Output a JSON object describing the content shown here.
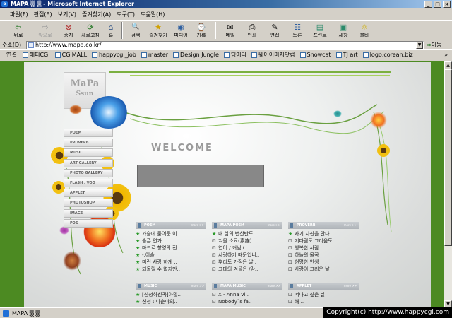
{
  "window": {
    "title": "MAPA ▒ ▒ - Microsoft Internet Explorer"
  },
  "menu": [
    "파일(F)",
    "편집(E)",
    "보기(V)",
    "즐겨찾기(A)",
    "도구(T)",
    "도움말(H)"
  ],
  "toolbar": [
    {
      "label": "뒤로",
      "icon": "back-arrow-icon",
      "glyph": "⇦"
    },
    {
      "label": "앞으로",
      "icon": "forward-arrow-icon",
      "glyph": "⇨"
    },
    {
      "label": "중지",
      "icon": "stop-icon",
      "glyph": "⊗"
    },
    {
      "label": "새로고침",
      "icon": "refresh-icon",
      "glyph": "⟳"
    },
    {
      "label": "홈",
      "icon": "home-icon",
      "glyph": "⌂"
    },
    {
      "label": "검색",
      "icon": "search-icon",
      "glyph": "🔍"
    },
    {
      "label": "즐겨찾기",
      "icon": "favorites-icon",
      "glyph": "★"
    },
    {
      "label": "미디어",
      "icon": "media-icon",
      "glyph": "◉"
    },
    {
      "label": "기록",
      "icon": "history-icon",
      "glyph": "⌚"
    },
    {
      "label": "메일",
      "icon": "mail-icon",
      "glyph": "✉"
    },
    {
      "label": "인쇄",
      "icon": "print-icon",
      "glyph": "⎙"
    },
    {
      "label": "편집",
      "icon": "edit-icon",
      "glyph": "✎"
    },
    {
      "label": "토론",
      "icon": "discuss-icon",
      "glyph": "☷"
    },
    {
      "label": "프린트",
      "icon": "printer-icon",
      "glyph": "▤"
    },
    {
      "label": "새창",
      "icon": "new-window-icon",
      "glyph": "▣"
    },
    {
      "label": "불바",
      "icon": "lightbulb-icon",
      "glyph": "☼"
    }
  ],
  "address": {
    "label": "주소(D)",
    "url": "http://www.mapa.co.kr/",
    "go_label": "이동"
  },
  "links": {
    "label": "연결",
    "items": [
      "해피CGI",
      "CGIMALL",
      "happycgi_job",
      "master",
      "Design Jungle",
      "딩어리",
      "웨어이미지닷컴",
      "Snowcat",
      "TJ art",
      "logo,corean,biz"
    ]
  },
  "site": {
    "logo_line1": "MaPa",
    "logo_line2": "Ssun",
    "welcome": "WELCOME",
    "nav": [
      "POEM",
      "PROVERB",
      "MUSIC",
      "ART GALLERY",
      "PHOTO GALLERY",
      "FLASH . VOD",
      "APPLET",
      "PHOTOSHOP",
      "IMAGE",
      "PDS"
    ],
    "more_label": "more >>",
    "panels": [
      {
        "title": "POEM",
        "items": [
          "가슴에 묻어둔 이..",
          "슬픈 연가",
          "마크로 향영의 진..",
          "-,이슬",
          "미런 사랑 하게 ..",
          "되돌릴 수 없지만.."
        ]
      },
      {
        "title": "MAPA POEM",
        "items": [
          "내 삶의 변산반도..",
          "겨울 소묘(素描)..",
          "연어 / 커님 (..",
          "사랑하기 때문입니..",
          "뿌리도 가점은 날..",
          "그대의 겨울은 /감.."
        ]
      },
      {
        "title": "PROVERB",
        "items": [
          "자기 자신을 안다..",
          "기다림도 그리움도",
          "행복한 사람",
          "하늘의 물꼭",
          "현명한 인생",
          "사랑이 그리운 날"
        ]
      },
      {
        "title": "MUSIC",
        "items": [
          "[신청하신곡]아많..",
          "신청 : 나춘마의.."
        ]
      },
      {
        "title": "MAPA MUSIC",
        "items": [
          "X - Anna Vi..",
          "Nobody`s fa.."
        ]
      },
      {
        "title": "APPLET",
        "items": [
          "떠나고 싶은 날",
          "해 .."
        ]
      }
    ]
  },
  "status": {
    "text": "MAPA ▒ ▒"
  },
  "copyright": "Copyright(c) http://www.happycgi.com"
}
